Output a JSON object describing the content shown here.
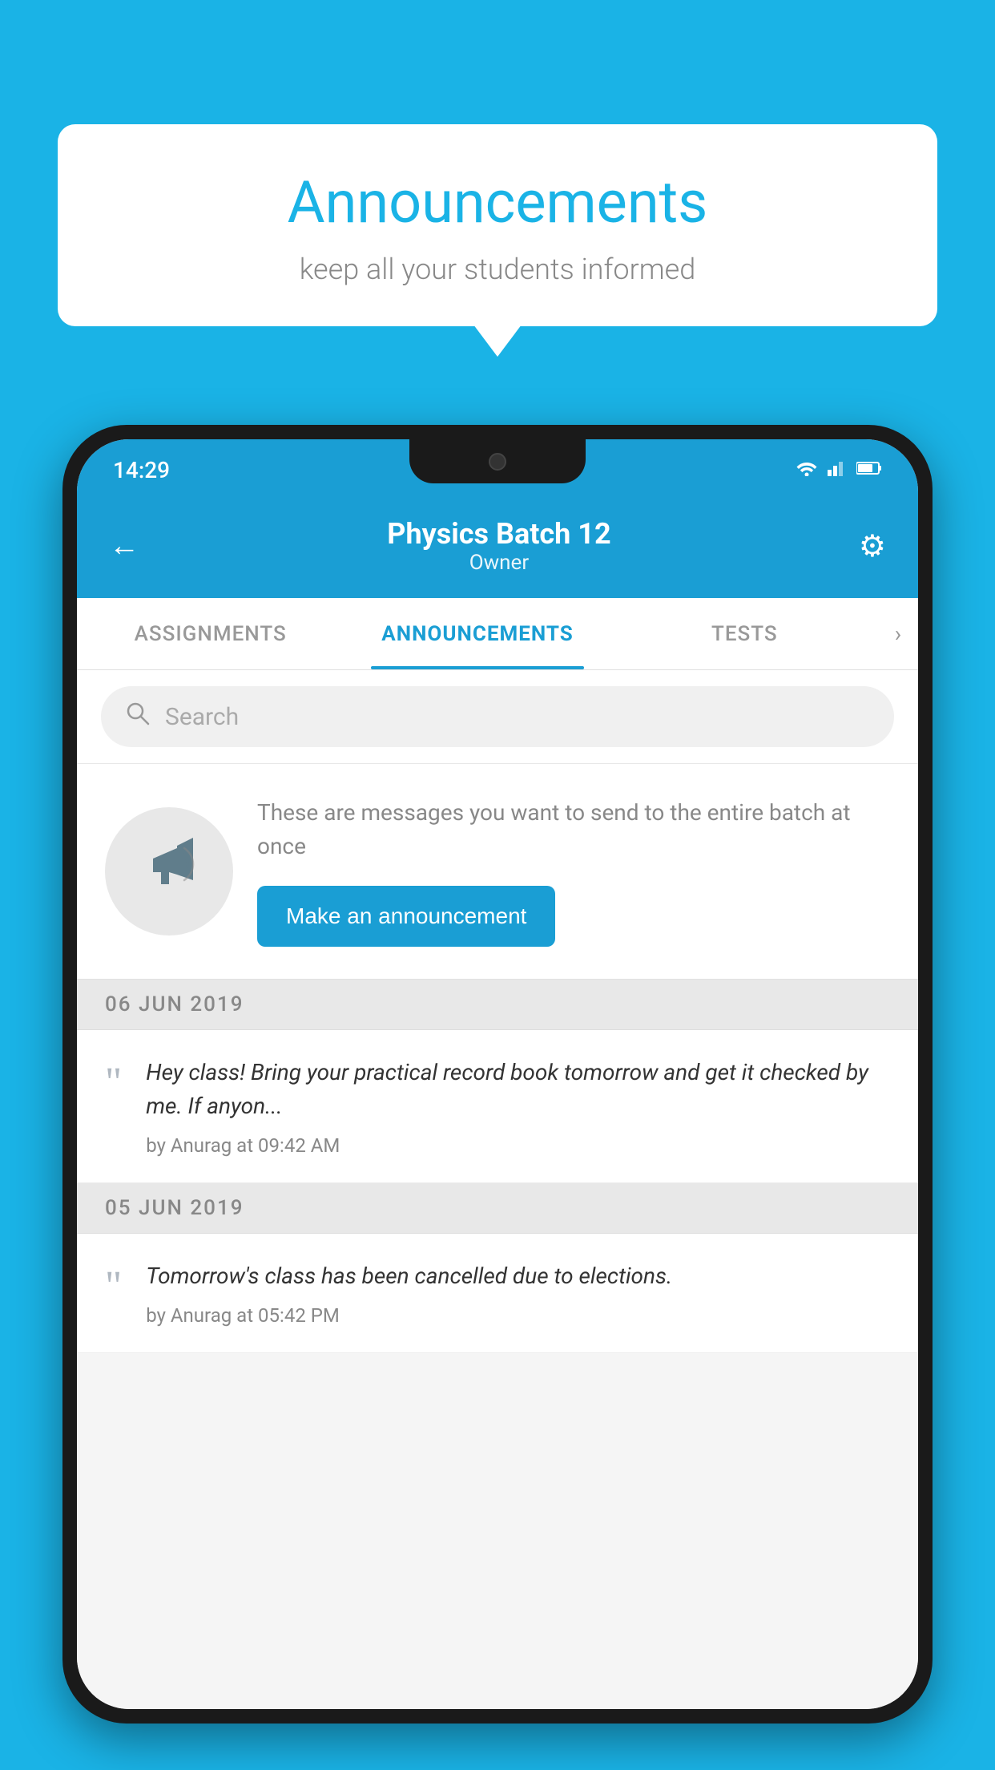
{
  "background_color": "#1ab3e6",
  "speech_bubble": {
    "title": "Announcements",
    "subtitle": "keep all your students informed"
  },
  "phone": {
    "status_bar": {
      "time": "14:29",
      "wifi": "▲",
      "signal": "▲",
      "battery": "▐"
    },
    "header": {
      "title": "Physics Batch 12",
      "subtitle": "Owner",
      "back_label": "←",
      "gear_label": "⚙"
    },
    "tabs": [
      {
        "label": "ASSIGNMENTS",
        "active": false
      },
      {
        "label": "ANNOUNCEMENTS",
        "active": true
      },
      {
        "label": "TESTS",
        "active": false
      }
    ],
    "search": {
      "placeholder": "Search"
    },
    "promo": {
      "description": "These are messages you want to send to the entire batch at once",
      "button_label": "Make an announcement"
    },
    "announcements": [
      {
        "date": "06  JUN  2019",
        "text": "Hey class! Bring your practical record book tomorrow and get it checked by me. If anyon...",
        "meta": "by Anurag at 09:42 AM"
      },
      {
        "date": "05  JUN  2019",
        "text": "Tomorrow's class has been cancelled due to elections.",
        "meta": "by Anurag at 05:42 PM"
      }
    ]
  }
}
